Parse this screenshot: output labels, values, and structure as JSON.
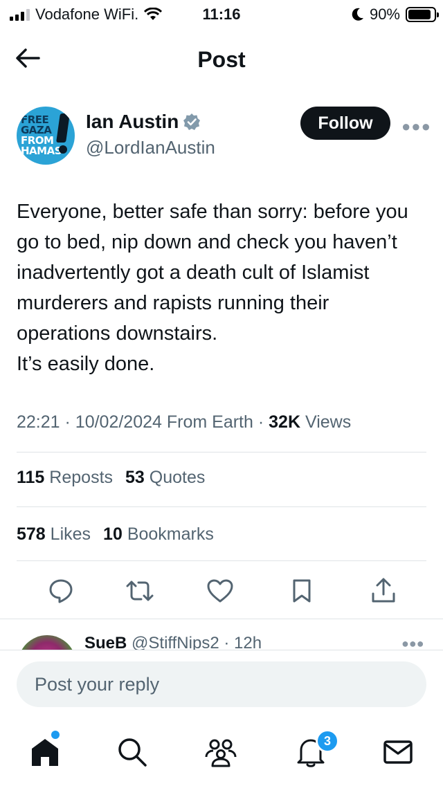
{
  "status_bar": {
    "carrier": "Vodafone WiFi.",
    "time": "11:16",
    "battery": "90%",
    "battery_level": 0.9
  },
  "header": {
    "title": "Post"
  },
  "author": {
    "name": "Ian Austin",
    "handle": "@LordIanAustin",
    "follow_label": "Follow",
    "avatar": {
      "line1": "FREE",
      "line2": "GAZA",
      "line3": "FROM",
      "line4": "HAMAS"
    }
  },
  "tweet": {
    "lines": [
      "Everyone, better safe than sorry: before you go to bed, nip down and check you haven’t inadvertently got a death cult of Islamist murderers and rapists running their operations downstairs.",
      "It’s easily done."
    ]
  },
  "meta": {
    "time": "22:21",
    "date": "10/02/2024",
    "location": "From Earth",
    "views_count": "32K",
    "views_label": "Views"
  },
  "stats": {
    "reposts_count": "115",
    "reposts_label": "Reposts",
    "quotes_count": "53",
    "quotes_label": "Quotes",
    "likes_count": "578",
    "likes_label": "Likes",
    "bookmarks_count": "10",
    "bookmarks_label": "Bookmarks"
  },
  "actions": [
    "reply-icon",
    "repost-icon",
    "like-icon",
    "bookmark-icon",
    "share-icon"
  ],
  "reply_preview": {
    "name": "SueB",
    "handle": "@StiffNips2",
    "age": "12h"
  },
  "reply_input": {
    "placeholder": "Post your reply"
  },
  "tab_bar": {
    "notifications_badge": "3"
  },
  "colors": {
    "accent": "#1d9bf0",
    "verified": "#829aab",
    "text": "#0f1419",
    "muted": "#536471"
  }
}
